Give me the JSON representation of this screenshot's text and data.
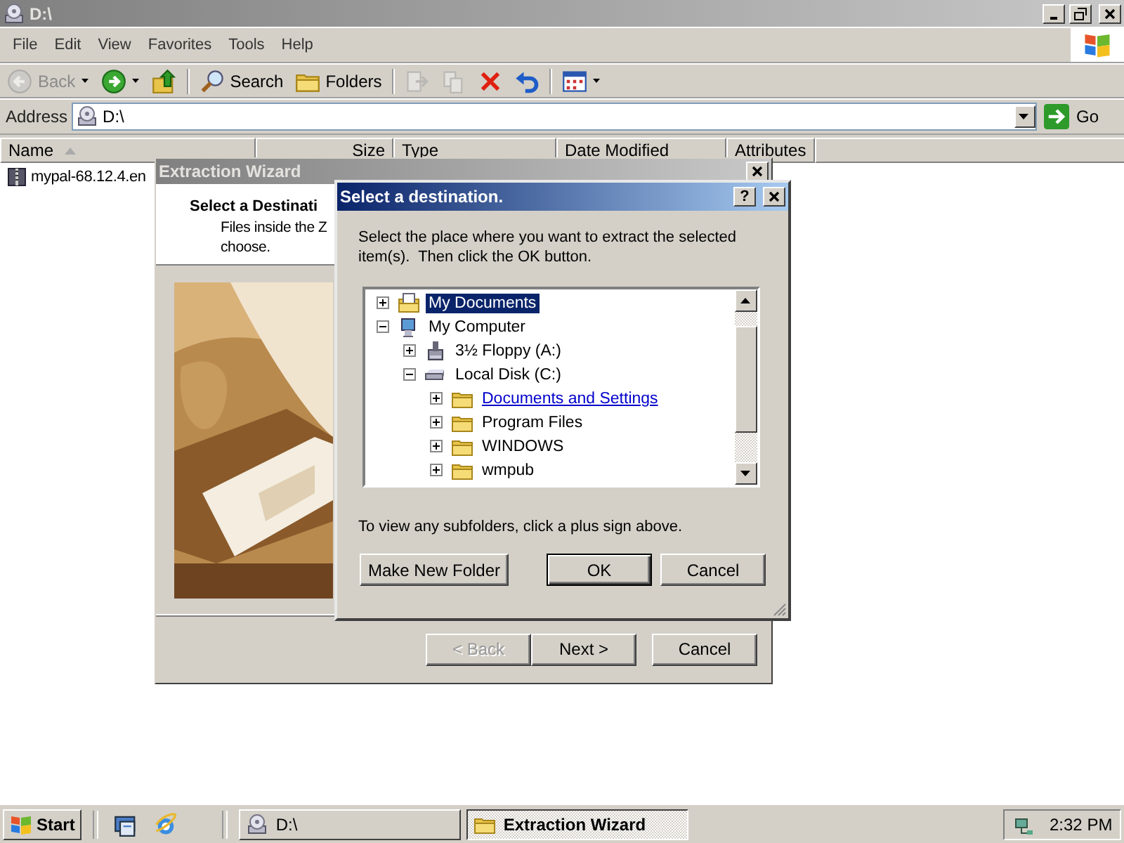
{
  "explorer": {
    "title": "D:\\",
    "menu": [
      "File",
      "Edit",
      "View",
      "Favorites",
      "Tools",
      "Help"
    ],
    "toolbar": [
      {
        "kind": "back",
        "label": "Back",
        "disabled": true
      },
      {
        "kind": "forward",
        "disabled": false
      },
      {
        "kind": "up",
        "disabled": false
      },
      {
        "kind": "search",
        "label": "Search",
        "disabled": false
      },
      {
        "kind": "folders",
        "label": "Folders",
        "disabled": false
      },
      {
        "kind": "move",
        "disabled": true
      },
      {
        "kind": "copy",
        "disabled": true
      },
      {
        "kind": "delete",
        "disabled": false
      },
      {
        "kind": "undo",
        "disabled": false
      },
      {
        "kind": "views",
        "disabled": false
      }
    ],
    "address": {
      "label": "Address",
      "value": "D:\\",
      "go": "Go"
    },
    "columns": [
      {
        "label": "Name",
        "sorted": true
      },
      {
        "label": "Size",
        "sorted": false
      },
      {
        "label": "Type",
        "sorted": false
      },
      {
        "label": "Date Modified",
        "sorted": false
      },
      {
        "label": "Attributes",
        "sorted": false
      }
    ],
    "files": [
      {
        "name": "mypal-68.12.4.en"
      }
    ]
  },
  "wizard": {
    "title": "Extraction Wizard",
    "heading": "Select a Destinati",
    "lines": [
      "Files inside the Z",
      "choose."
    ],
    "buttons": [
      {
        "label": "< Back",
        "disabled": true
      },
      {
        "label": "Next >",
        "disabled": false
      },
      {
        "label": "Cancel",
        "disabled": false
      }
    ]
  },
  "dialog": {
    "title": "Select a destination.",
    "help": "?",
    "prompt": "Select the place where you want to extract the selected item(s).  Then click the OK button.",
    "tree": [
      {
        "label": "My Documents",
        "kind": "documents",
        "expanded": false,
        "selected": true,
        "hot": false
      },
      {
        "label": "My Computer",
        "kind": "computer",
        "expanded": true,
        "selected": false,
        "hot": false,
        "children": [
          {
            "label": "3½ Floppy (A:)",
            "kind": "floppy",
            "expanded": false,
            "selected": false,
            "hot": false
          },
          {
            "label": "Local Disk (C:)",
            "kind": "disk",
            "expanded": true,
            "selected": false,
            "hot": false,
            "children": [
              {
                "label": "Documents and Settings",
                "kind": "folder",
                "expanded": false,
                "selected": false,
                "hot": true
              },
              {
                "label": "Program Files",
                "kind": "folder",
                "expanded": false,
                "selected": false,
                "hot": false
              },
              {
                "label": "WINDOWS",
                "kind": "folder",
                "expanded": false,
                "selected": false,
                "hot": false
              },
              {
                "label": "wmpub",
                "kind": "folder",
                "expanded": false,
                "selected": false,
                "hot": false
              }
            ]
          }
        ]
      }
    ],
    "hint": "To view any subfolders, click a plus sign above.",
    "buttons": [
      {
        "label": "Make New Folder",
        "default": false
      },
      {
        "label": "OK",
        "default": true
      },
      {
        "label": "Cancel",
        "default": false
      }
    ]
  },
  "taskbar": {
    "start": "Start",
    "quick_launch": [
      {
        "kind": "desktop"
      },
      {
        "kind": "browser"
      }
    ],
    "tasks": [
      {
        "label": "D:\\",
        "kind": "drive",
        "selected": false
      },
      {
        "label": "Extraction Wizard",
        "kind": "folder",
        "selected": true
      }
    ],
    "clock": "2:32 PM"
  }
}
